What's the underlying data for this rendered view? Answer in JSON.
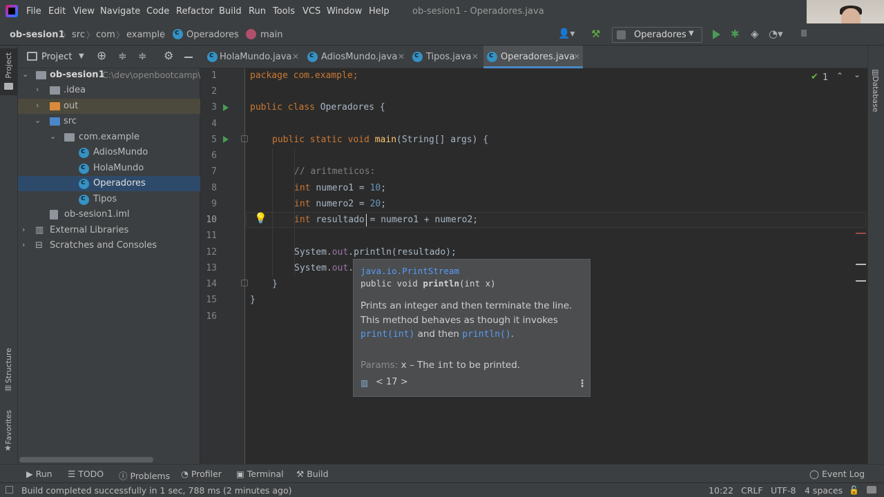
{
  "menu": {
    "items": [
      "File",
      "Edit",
      "View",
      "Navigate",
      "Code",
      "Refactor",
      "Build",
      "Run",
      "Tools",
      "VCS",
      "Window",
      "Help"
    ],
    "window_title": "ob-sesion1 - Operadores.java"
  },
  "breadcrumb": {
    "project": "ob-sesion1",
    "src": "src",
    "com": "com",
    "example": "example",
    "class": "Operadores",
    "method": "main"
  },
  "run_config": {
    "selected": "Operadores"
  },
  "project_panel": {
    "title": "Project",
    "root_label": "ob-sesion1",
    "root_path": "C:\\dev\\openbootcamp\\",
    "idea": ".idea",
    "out": "out",
    "src": "src",
    "package": "com.example",
    "classes": [
      "AdiosMundo",
      "HolaMundo",
      "Operadores",
      "Tipos"
    ],
    "iml": "ob-sesion1.iml",
    "external": "External Libraries",
    "scratches": "Scratches and Consoles"
  },
  "left_strip": {
    "project": "Project",
    "structure": "Structure",
    "favorites": "Favorites"
  },
  "right_strip": {
    "database": "Database"
  },
  "tabs": [
    {
      "label": "HolaMundo.java"
    },
    {
      "label": "AdiosMundo.java"
    },
    {
      "label": "Tipos.java"
    },
    {
      "label": "Operadores.java"
    }
  ],
  "editor": {
    "inspection_count": "1",
    "line_numbers": [
      "1",
      "2",
      "3",
      "4",
      "5",
      "6",
      "7",
      "8",
      "9",
      "10",
      "11",
      "12",
      "13",
      "14",
      "15",
      "16"
    ],
    "current_line": "10",
    "code": {
      "l1": "package com.example;",
      "l3_kw": "public class",
      "l3_name": "Operadores {",
      "l5_kw": "public static void",
      "l5_fn": "main",
      "l5_rest": "(String[] args) {",
      "l7": "// aritmeticos:",
      "l8_kw": "int",
      "l8_rest": "numero1 = ",
      "l8_num": "10",
      "l9_kw": "int",
      "l9_rest": "numero2 = ",
      "l9_num": "20",
      "l10_kw": "int",
      "l10_rest": "resultado = numero1 + numero2;",
      "l12_cls": "System.",
      "l12_out": "out",
      "l12_rest": ".println(resultado);",
      "l13_cls": "System.",
      "l13_out": "out",
      "l13_rest": ".",
      "l14": "}",
      "l15": "}"
    }
  },
  "doc_popup": {
    "package": "java.io.PrintStream",
    "sig_prefix": "public void ",
    "sig_name": "println",
    "sig_args": "(int x)",
    "body_1": "Prints an integer and then terminate the line.",
    "body_2": "This method behaves as though it invokes",
    "link_1": "print(int)",
    "and_then": " and then ",
    "link_2": "println()",
    "period": ".",
    "params_label": "Params:",
    "params_x": " x – The ",
    "params_int": "int",
    "params_rest": " to be printed.",
    "jdk": "< 17 >"
  },
  "bottom_tools": [
    "Run",
    "TODO",
    "Problems",
    "Profiler",
    "Terminal",
    "Build"
  ],
  "event_log": "Event Log",
  "status": {
    "message": "Build completed successfully in 1 sec, 788 ms (2 minutes ago)",
    "position": "10:22",
    "line_sep": "CRLF",
    "encoding": "UTF-8",
    "indent": "4 spaces"
  }
}
